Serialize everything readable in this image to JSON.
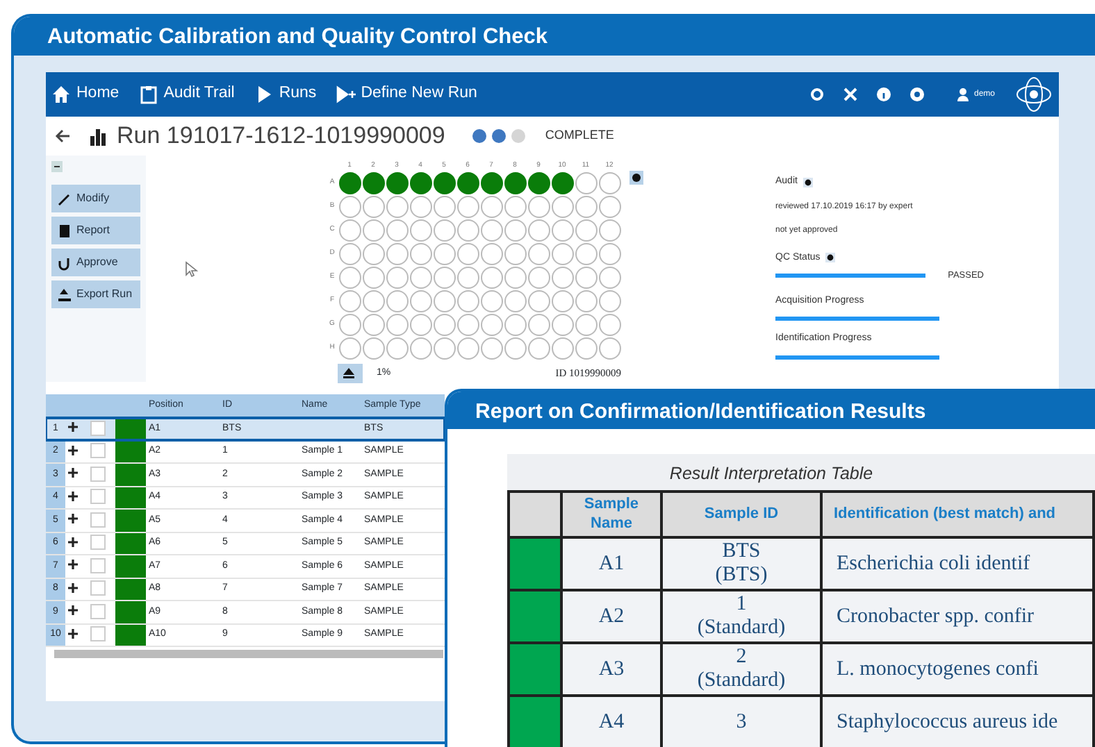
{
  "panel": {
    "title": "Automatic Calibration and Quality Control Check"
  },
  "app": {
    "nav": {
      "items": [
        {
          "label": "Home"
        },
        {
          "label": "Audit Trail"
        },
        {
          "label": "Runs"
        },
        {
          "label": "Define New Run"
        }
      ],
      "user": "demo"
    },
    "run": {
      "title": "Run 191017-1612-1019990009",
      "dots": [
        true,
        true,
        false
      ],
      "status": "COMPLETE"
    },
    "actions": [
      "Modify",
      "Report",
      "Approve",
      "Export Run"
    ],
    "plate": {
      "columns": [
        "1",
        "2",
        "3",
        "4",
        "5",
        "6",
        "7",
        "8",
        "9",
        "10",
        "11",
        "12"
      ],
      "rows": [
        {
          "label": "A",
          "filled": [
            true,
            true,
            true,
            true,
            true,
            true,
            true,
            true,
            true,
            true,
            false,
            false
          ]
        },
        {
          "label": "B",
          "filled": [
            false,
            false,
            false,
            false,
            false,
            false,
            false,
            false,
            false,
            false,
            false,
            false
          ]
        },
        {
          "label": "C",
          "filled": [
            false,
            false,
            false,
            false,
            false,
            false,
            false,
            false,
            false,
            false,
            false,
            false
          ]
        },
        {
          "label": "D",
          "filled": [
            false,
            false,
            false,
            false,
            false,
            false,
            false,
            false,
            false,
            false,
            false,
            false
          ]
        },
        {
          "label": "E",
          "filled": [
            false,
            false,
            false,
            false,
            false,
            false,
            false,
            false,
            false,
            false,
            false,
            false
          ]
        },
        {
          "label": "F",
          "filled": [
            false,
            false,
            false,
            false,
            false,
            false,
            false,
            false,
            false,
            false,
            false,
            false
          ]
        },
        {
          "label": "G",
          "filled": [
            false,
            false,
            false,
            false,
            false,
            false,
            false,
            false,
            false,
            false,
            false,
            false
          ]
        },
        {
          "label": "H",
          "filled": [
            false,
            false,
            false,
            false,
            false,
            false,
            false,
            false,
            false,
            false,
            false,
            false
          ]
        }
      ],
      "progress": "1%",
      "id": "ID 1019990009"
    },
    "info": {
      "audit_label": "Audit",
      "reviewed": "reviewed 17.10.2019 16:17 by expert",
      "approval": "not yet approved",
      "qc": {
        "label": "QC Status",
        "level": 1,
        "result": "PASSED"
      },
      "progress": [
        {
          "label": "Acquisition Progress",
          "level": 1
        },
        {
          "label": "Identification Progress",
          "level": 1
        }
      ]
    },
    "table": {
      "columns": [
        "Position",
        "ID",
        "Name",
        "Sample Type"
      ],
      "rows": [
        {
          "number": "1",
          "selected": true,
          "checked": false,
          "color": "#0b7d0b",
          "position": "A1",
          "id": "BTS",
          "type": "BTS"
        },
        {
          "number": "2",
          "selected": false,
          "checked": false,
          "color": "#0b7d0b",
          "position": "A2",
          "id": "1",
          "name": "Sample 1",
          "type": "SAMPLE"
        },
        {
          "number": "3",
          "selected": false,
          "checked": false,
          "color": "#0b7d0b",
          "position": "A3",
          "id": "2",
          "name": "Sample 2",
          "type": "SAMPLE"
        },
        {
          "number": "4",
          "selected": false,
          "checked": false,
          "color": "#0b7d0b",
          "position": "A4",
          "id": "3",
          "name": "Sample 3",
          "type": "SAMPLE"
        },
        {
          "number": "5",
          "selected": false,
          "checked": false,
          "color": "#0b7d0b",
          "position": "A5",
          "id": "4",
          "name": "Sample 4",
          "type": "SAMPLE"
        },
        {
          "number": "6",
          "selected": false,
          "checked": false,
          "color": "#0b7d0b",
          "position": "A6",
          "id": "5",
          "name": "Sample 5",
          "type": "SAMPLE"
        },
        {
          "number": "7",
          "selected": false,
          "checked": false,
          "color": "#0b7d0b",
          "position": "A7",
          "id": "6",
          "name": "Sample 6",
          "type": "SAMPLE"
        },
        {
          "number": "8",
          "selected": false,
          "checked": false,
          "color": "#0b7d0b",
          "position": "A8",
          "id": "7",
          "name": "Sample 7",
          "type": "SAMPLE"
        },
        {
          "number": "9",
          "selected": false,
          "checked": false,
          "color": "#0b7d0b",
          "position": "A9",
          "id": "8",
          "name": "Sample 8",
          "type": "SAMPLE"
        },
        {
          "number": "10",
          "selected": false,
          "checked": false,
          "color": "#0b7d0b",
          "position": "A10",
          "id": "9",
          "name": "Sample 9",
          "type": "SAMPLE"
        }
      ]
    }
  },
  "report": {
    "title": "Report on Confirmation/Identification Results",
    "caption": "Result Interpretation Table",
    "columns": [
      "Sample Name",
      "Sample ID",
      "Identification (best match) and"
    ],
    "rows": [
      {
        "color": "#00a650",
        "name": "A1",
        "id_lines": [
          "BTS",
          "(BTS)"
        ],
        "identification": "Escherichia coli identif"
      },
      {
        "color": "#00a650",
        "name": "A2",
        "id_lines": [
          "1",
          "(Standard)"
        ],
        "identification": "Cronobacter spp. confir"
      },
      {
        "color": "#00a650",
        "name": "A3",
        "id_lines": [
          "2",
          "(Standard)"
        ],
        "identification": "L. monocytogenes confi"
      },
      {
        "color": "#00a650",
        "name": "A4",
        "id_lines": [
          "3"
        ],
        "identification": "Staphylococcus aureus ide"
      }
    ]
  }
}
